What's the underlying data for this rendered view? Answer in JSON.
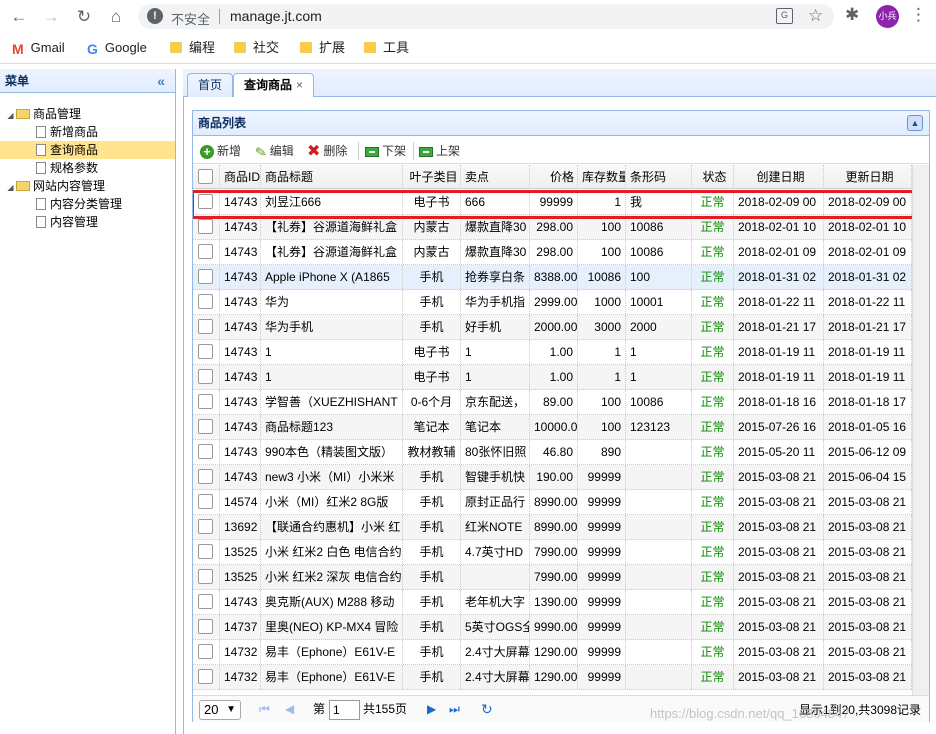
{
  "browser": {
    "insecure_label": "不安全",
    "url": "manage.jt.com",
    "profile": "小兵",
    "bookmarks": [
      {
        "label": "Gmail"
      },
      {
        "label": "Google"
      },
      {
        "label": "编程"
      },
      {
        "label": "社交"
      },
      {
        "label": "扩展"
      },
      {
        "label": "工具"
      }
    ]
  },
  "sidebar": {
    "title": "菜单",
    "groups": [
      {
        "label": "商品管理",
        "items": [
          "新增商品",
          "查询商品",
          "规格参数"
        ]
      },
      {
        "label": "网站内容管理",
        "items": [
          "内容分类管理",
          "内容管理"
        ]
      }
    ],
    "selected": "查询商品"
  },
  "tabs": [
    {
      "label": "首页"
    },
    {
      "label": "查询商品",
      "close": "×"
    }
  ],
  "panel": {
    "title": "商品列表"
  },
  "toolbar": {
    "add": "新增",
    "edit": "编辑",
    "delete": "删除",
    "offshelf": "下架",
    "onshelf": "上架"
  },
  "columns": [
    "商品ID",
    "商品标题",
    "叶子类目",
    "卖点",
    "价格",
    "库存数量",
    "条形码",
    "状态",
    "创建日期",
    "更新日期"
  ],
  "rows": [
    {
      "id": "14743",
      "title": "刘昱江666",
      "cat": "电子书",
      "sell": "666",
      "price": "99999",
      "num": "1",
      "barcode": "我",
      "status": "正常",
      "created": "2018-02-09 00",
      "updated": "2018-02-09 00"
    },
    {
      "id": "14743",
      "title": "【礼券】谷源道海鲜礼盒",
      "cat": "内蒙古",
      "sell": "爆款直降30",
      "price": "298.00",
      "num": "100",
      "barcode": "10086",
      "status": "正常",
      "created": "2018-02-01 10",
      "updated": "2018-02-01 10"
    },
    {
      "id": "14743",
      "title": "【礼券】谷源道海鲜礼盒",
      "cat": "内蒙古",
      "sell": "爆款直降30",
      "price": "298.00",
      "num": "100",
      "barcode": "10086",
      "status": "正常",
      "created": "2018-02-01 09",
      "updated": "2018-02-01 09"
    },
    {
      "id": "14743",
      "title": "Apple iPhone X (A1865",
      "cat": "手机",
      "sell": "抢券享白条",
      "price": "8388.00",
      "num": "10086",
      "barcode": "100",
      "status": "正常",
      "created": "2018-01-31 02",
      "updated": "2018-01-31 02"
    },
    {
      "id": "14743",
      "title": "华为",
      "cat": "手机",
      "sell": "华为手机指",
      "price": "2999.00",
      "num": "1000",
      "barcode": "10001",
      "status": "正常",
      "created": "2018-01-22 11",
      "updated": "2018-01-22 11"
    },
    {
      "id": "14743",
      "title": "华为手机",
      "cat": "手机",
      "sell": "好手机",
      "price": "2000.00",
      "num": "3000",
      "barcode": "2000",
      "status": "正常",
      "created": "2018-01-21 17",
      "updated": "2018-01-21 17"
    },
    {
      "id": "14743",
      "title": "1",
      "cat": "电子书",
      "sell": "1",
      "price": "1.00",
      "num": "1",
      "barcode": "1",
      "status": "正常",
      "created": "2018-01-19 11",
      "updated": "2018-01-19 11"
    },
    {
      "id": "14743",
      "title": "1",
      "cat": "电子书",
      "sell": "1",
      "price": "1.00",
      "num": "1",
      "barcode": "1",
      "status": "正常",
      "created": "2018-01-19 11",
      "updated": "2018-01-19 11"
    },
    {
      "id": "14743",
      "title": "学智善（XUEZHISHANT",
      "cat": "0-6个月",
      "sell": "京东配送，",
      "price": "89.00",
      "num": "100",
      "barcode": "10086",
      "status": "正常",
      "created": "2018-01-18 16",
      "updated": "2018-01-18 17"
    },
    {
      "id": "14743",
      "title": "商品标题123",
      "cat": "笔记本",
      "sell": "笔记本",
      "price": "10000.0",
      "num": "100",
      "barcode": "123123",
      "status": "正常",
      "created": "2015-07-26 16",
      "updated": "2018-01-05 16"
    },
    {
      "id": "14743",
      "title": "990本色（精装图文版）",
      "cat": "教材教辅",
      "sell": "80张怀旧照",
      "price": "46.80",
      "num": "890",
      "barcode": "",
      "status": "正常",
      "created": "2015-05-20 11",
      "updated": "2015-06-12 09"
    },
    {
      "id": "14743",
      "title": "new3 小米（MI）小米米",
      "cat": "手机",
      "sell": "智键手机快",
      "price": "190.00",
      "num": "99999",
      "barcode": "",
      "status": "正常",
      "created": "2015-03-08 21",
      "updated": "2015-06-04 15"
    },
    {
      "id": "14574",
      "title": "小米（MI）红米2 8G版",
      "cat": "手机",
      "sell": "原封正品行",
      "price": "8990.00",
      "num": "99999",
      "barcode": "",
      "status": "正常",
      "created": "2015-03-08 21",
      "updated": "2015-03-08 21"
    },
    {
      "id": "13692",
      "title": "【联通合约惠机】小米 红",
      "cat": "手机",
      "sell": "红米NOTE",
      "price": "8990.00",
      "num": "99999",
      "barcode": "",
      "status": "正常",
      "created": "2015-03-08 21",
      "updated": "2015-03-08 21"
    },
    {
      "id": "13525",
      "title": "小米 红米2 白色 电信合约",
      "cat": "手机",
      "sell": "4.7英寸HD",
      "price": "7990.00",
      "num": "99999",
      "barcode": "",
      "status": "正常",
      "created": "2015-03-08 21",
      "updated": "2015-03-08 21"
    },
    {
      "id": "13525",
      "title": "小米 红米2 深灰 电信合约",
      "cat": "手机",
      "sell": "",
      "price": "7990.00",
      "num": "99999",
      "barcode": "",
      "status": "正常",
      "created": "2015-03-08 21",
      "updated": "2015-03-08 21"
    },
    {
      "id": "14743",
      "title": "奥克斯(AUX) M288 移动",
      "cat": "手机",
      "sell": "老年机大字",
      "price": "1390.00",
      "num": "99999",
      "barcode": "",
      "status": "正常",
      "created": "2015-03-08 21",
      "updated": "2015-03-08 21"
    },
    {
      "id": "14737",
      "title": "里奥(NEO) KP-MX4 冒险",
      "cat": "手机",
      "sell": "5英寸OGS全",
      "price": "9990.00",
      "num": "99999",
      "barcode": "",
      "status": "正常",
      "created": "2015-03-08 21",
      "updated": "2015-03-08 21"
    },
    {
      "id": "14732",
      "title": "易丰（Ephone）E61V-E",
      "cat": "手机",
      "sell": "2.4寸大屏幕",
      "price": "1290.00",
      "num": "99999",
      "barcode": "",
      "status": "正常",
      "created": "2015-03-08 21",
      "updated": "2015-03-08 21"
    },
    {
      "id": "14732",
      "title": "易丰（Ephone）E61V-E",
      "cat": "手机",
      "sell": "2.4寸大屏幕",
      "price": "1290.00",
      "num": "99999",
      "barcode": "",
      "status": "正常",
      "created": "2015-03-08 21",
      "updated": "2015-03-08 21"
    }
  ],
  "pager": {
    "page_size": "20",
    "page_prefix": "第",
    "page": "1",
    "page_suffix": "共155页",
    "info": "显示1到20,共3098记录"
  },
  "watermark": "https://blog.csdn.net/qq_16804847"
}
